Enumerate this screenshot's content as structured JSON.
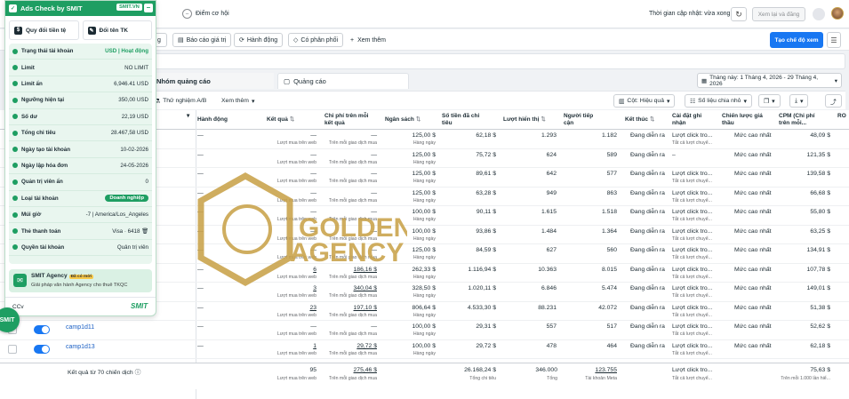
{
  "header": {
    "opportunity_label": "Điểm cơ hội",
    "updated_text": "Thời gian cập nhật: vừa xong",
    "review_button": "Xem lại và đăng"
  },
  "toolbar": {
    "partial_button": "g",
    "report_button": "Báo cáo giá trị",
    "action_button": "Hành động",
    "shareable_button": "Có phân phối",
    "more_button": "Xem thêm",
    "create_view_button": "Tạo chế độ xem"
  },
  "tabs": {
    "ad_sets": "Nhóm quảng cáo",
    "ads": "Quảng cáo"
  },
  "date_range": "Tháng này: 1 Tháng 4, 2026 - 29 Tháng 4, 2026",
  "filters": {
    "ab_test": "Thử nghiệm A/B",
    "view_more": "Xem thêm",
    "columns": "Cột: Hiệu quả",
    "breakdown": "Số liệu chia nhỏ"
  },
  "table": {
    "headers": [
      "Hành động",
      "Kết quả",
      "Chi phí trên mỗi kết quả",
      "Ngân sách",
      "Số tiền đã chi tiêu",
      "Lượt hiển thị",
      "Người tiếp cận",
      "Kết thúc",
      "Cài đặt ghi nhận",
      "Chiến lược giá thầu",
      "CPM (Chi phí trên mỗi...",
      "RO"
    ],
    "rows": [
      {
        "action": "—",
        "result": "—",
        "result_sub": "Lượt mua trên web",
        "cpr": "—",
        "cpr_sub": "Trên mỗi giao dịch mua",
        "budget": "125,00 $",
        "budget_sub": "Hàng ngày",
        "spent": "62,18 $",
        "impr": "1.293",
        "reach": "1.182",
        "end": "Đang diễn ra",
        "attr": "Lượt click tro...",
        "attr_sub": "Tắt cả lượt chuyể...",
        "bid": "Mức cao nhất",
        "cpm": "48,09 $"
      },
      {
        "action": "—",
        "result": "—",
        "result_sub": "Lượt mua trên web",
        "cpr": "—",
        "cpr_sub": "Trên mỗi giao dịch mua",
        "budget": "125,00 $",
        "budget_sub": "Hàng ngày",
        "spent": "75,72 $",
        "impr": "624",
        "reach": "589",
        "end": "Đang diễn ra",
        "attr": "–",
        "attr_sub": "",
        "bid": "Mức cao nhất",
        "cpm": "121,35 $"
      },
      {
        "action": "—",
        "result": "—",
        "result_sub": "Lượt mua trên web",
        "cpr": "—",
        "cpr_sub": "Trên mỗi giao dịch mua",
        "budget": "125,00 $",
        "budget_sub": "Hàng ngày",
        "spent": "89,61 $",
        "impr": "642",
        "reach": "577",
        "end": "Đang diễn ra",
        "attr": "Lượt click tro...",
        "attr_sub": "Tắt cả lượt chuyể...",
        "bid": "Mức cao nhất",
        "cpm": "139,58 $"
      },
      {
        "action": "—",
        "result": "—",
        "result_sub": "Lượt mua trên web",
        "cpr": "—",
        "cpr_sub": "Trên mỗi giao dịch mua",
        "budget": "125,00 $",
        "budget_sub": "Hàng ngày",
        "spent": "63,28 $",
        "impr": "949",
        "reach": "863",
        "end": "Đang diễn ra",
        "attr": "Lượt click tro...",
        "attr_sub": "Tắt cả lượt chuyể...",
        "bid": "Mức cao nhất",
        "cpm": "66,68 $"
      },
      {
        "action": "—",
        "result": "—",
        "result_sub": "Lượt mua trên web",
        "cpr": "—",
        "cpr_sub": "Trên mỗi giao dịch mua",
        "budget": "100,00 $",
        "budget_sub": "Hàng ngày",
        "spent": "90,11 $",
        "impr": "1.615",
        "reach": "1.518",
        "end": "Đang diễn ra",
        "attr": "Lượt click tro...",
        "attr_sub": "Tắt cả lượt chuyể...",
        "bid": "Mức cao nhất",
        "cpm": "55,80 $"
      },
      {
        "action": "—",
        "result": "—",
        "result_sub": "Lượt mua trên web",
        "cpr": "—",
        "cpr_sub": "Trên mỗi giao dịch mua",
        "budget": "100,00 $",
        "budget_sub": "Hàng ngày",
        "spent": "93,86 $",
        "impr": "1.484",
        "reach": "1.364",
        "end": "Đang diễn ra",
        "attr": "Lượt click tro...",
        "attr_sub": "Tắt cả lượt chuyể...",
        "bid": "Mức cao nhất",
        "cpm": "63,25 $"
      },
      {
        "action": "—",
        "result": "—",
        "result_sub": "Lượt mua trên web",
        "cpr": "—",
        "cpr_sub": "Trên mỗi giao dịch mua",
        "budget": "125,00 $",
        "budget_sub": "Hàng ngày",
        "spent": "84,59 $",
        "impr": "627",
        "reach": "560",
        "end": "Đang diễn ra",
        "attr": "Lượt click tro...",
        "attr_sub": "Tắt cả lượt chuyể...",
        "bid": "Mức cao nhất",
        "cpm": "134,91 $"
      },
      {
        "action": "—",
        "result": "6",
        "result_sub": "Lượt mua trên web",
        "cpr": "186,16 $",
        "cpr_sub": "Trên mỗi giao dịch mua",
        "budget": "262,33 $",
        "budget_sub": "Hàng ngày",
        "spent": "1.116,94 $",
        "impr": "10.363",
        "reach": "8.015",
        "end": "Đang diễn ra",
        "attr": "Lượt click tro...",
        "attr_sub": "Tắt cả lượt chuyể...",
        "bid": "Mức cao nhất",
        "cpm": "107,78 $"
      },
      {
        "action": "—",
        "result": "3",
        "result_sub": "Lượt mua trên web",
        "cpr": "340,04 $",
        "cpr_sub": "Trên mỗi giao dịch mua",
        "budget": "328,50 $",
        "budget_sub": "Hàng ngày",
        "spent": "1.020,11 $",
        "impr": "6.846",
        "reach": "5.474",
        "end": "Đang diễn ra",
        "attr": "Lượt click tro...",
        "attr_sub": "Tắt cả lượt chuyể...",
        "bid": "Mức cao nhất",
        "cpm": "149,01 $"
      },
      {
        "action": "—",
        "result": "23",
        "result_sub": "Lượt mua trên web",
        "cpr": "197,10 $",
        "cpr_sub": "Trên mỗi giao dịch mua",
        "budget": "806,64 $",
        "budget_sub": "Hàng ngày",
        "spent": "4.533,30 $",
        "impr": "88.231",
        "reach": "42.072",
        "end": "Đang diễn ra",
        "attr": "Lượt click tro...",
        "attr_sub": "Tắt cả lượt chuyể...",
        "bid": "Mức cao nhất",
        "cpm": "51,38 $"
      },
      {
        "name": "camp1d11",
        "action": "—",
        "result": "—",
        "result_sub": "Lượt mua trên web",
        "cpr": "—",
        "cpr_sub": "Trên mỗi giao dịch mua",
        "budget": "100,00 $",
        "budget_sub": "Hàng ngày",
        "spent": "29,31 $",
        "impr": "557",
        "reach": "517",
        "end": "Đang diễn ra",
        "attr": "Lượt click tro...",
        "attr_sub": "Tắt cả lượt chuyể...",
        "bid": "Mức cao nhất",
        "cpm": "52,62 $"
      },
      {
        "name": "camp1d13",
        "action": "—",
        "result": "1",
        "result_sub": "Lượt mua trên web",
        "cpr": "29,72 $",
        "cpr_sub": "Trên mỗi giao dịch mua",
        "budget": "100,00 $",
        "budget_sub": "Hàng ngày",
        "spent": "29,72 $",
        "impr": "478",
        "reach": "464",
        "end": "Đang diễn ra",
        "attr": "Lượt click tro...",
        "attr_sub": "Tắt cả lượt chuyể...",
        "bid": "Mức cao nhất",
        "cpm": "62,18 $"
      }
    ],
    "totals": {
      "label": "Kết quả từ 70 chiến dịch",
      "result": "95",
      "result_sub": "Lượt mua trên web",
      "cpr": "275,46 $",
      "cpr_sub": "Trên mỗi giao dịch mua",
      "spent": "26.168,24 $",
      "spent_sub": "Tổng chi tiêu",
      "impr": "346.000",
      "impr_sub": "Tổng",
      "reach": "123.755",
      "reach_sub": "Tài khoản Meta",
      "attr": "Lượt click tro...",
      "attr_sub": "Tắt cả lượt chuyể...",
      "cpm": "75,63 $",
      "cpm_sub": "Trên mỗi 1.000 lần hiể..."
    }
  },
  "extension": {
    "title": "Ads Check by SMIT",
    "badge": "SMIT.VN",
    "change_currency": "Quy đổi tiền tệ",
    "rename_tk": "Đổi tên TK",
    "info": [
      {
        "label": "Trạng thái tài khoản",
        "value": "USD | Hoạt động"
      },
      {
        "label": "Limit",
        "value": "NO LIMIT"
      },
      {
        "label": "Limit ẩn",
        "value": "6,946.41 USD"
      },
      {
        "label": "Ngưỡng hiện tại",
        "value": "350,00 USD"
      },
      {
        "label": "Số dư",
        "value": "22,19 USD"
      },
      {
        "label": "Tổng chi tiêu",
        "value": "28.467,58 USD"
      },
      {
        "label": "Ngày tạo tài khoản",
        "value": "10-02-2026"
      },
      {
        "label": "Ngày lập hóa đơn",
        "value": "24-05-2026"
      },
      {
        "label": "Quản trị viên ẩn",
        "value": "0"
      },
      {
        "label": "Loại tài khoản",
        "value": "Doanh nghiệp"
      },
      {
        "label": "Múi giờ",
        "value": "-7 | America/Los_Angeles"
      },
      {
        "label": "Thẻ thanh toán",
        "value": "Visa · 6418"
      },
      {
        "label": "Quyền tài khoản",
        "value": "Quản trị viên"
      }
    ],
    "agency_title": "SMIT Agency",
    "agency_tag": "Đã có mới",
    "agency_sub": "Giải pháp văn hành Agency cho thuê TKQC",
    "footer_cc": "CCv",
    "footer_brand": "SMIT",
    "fab_label": "SMIT"
  },
  "watermark": {
    "line1": "GOLDEN",
    "line2": "AGENCY",
    "color": "#c9a24a"
  }
}
